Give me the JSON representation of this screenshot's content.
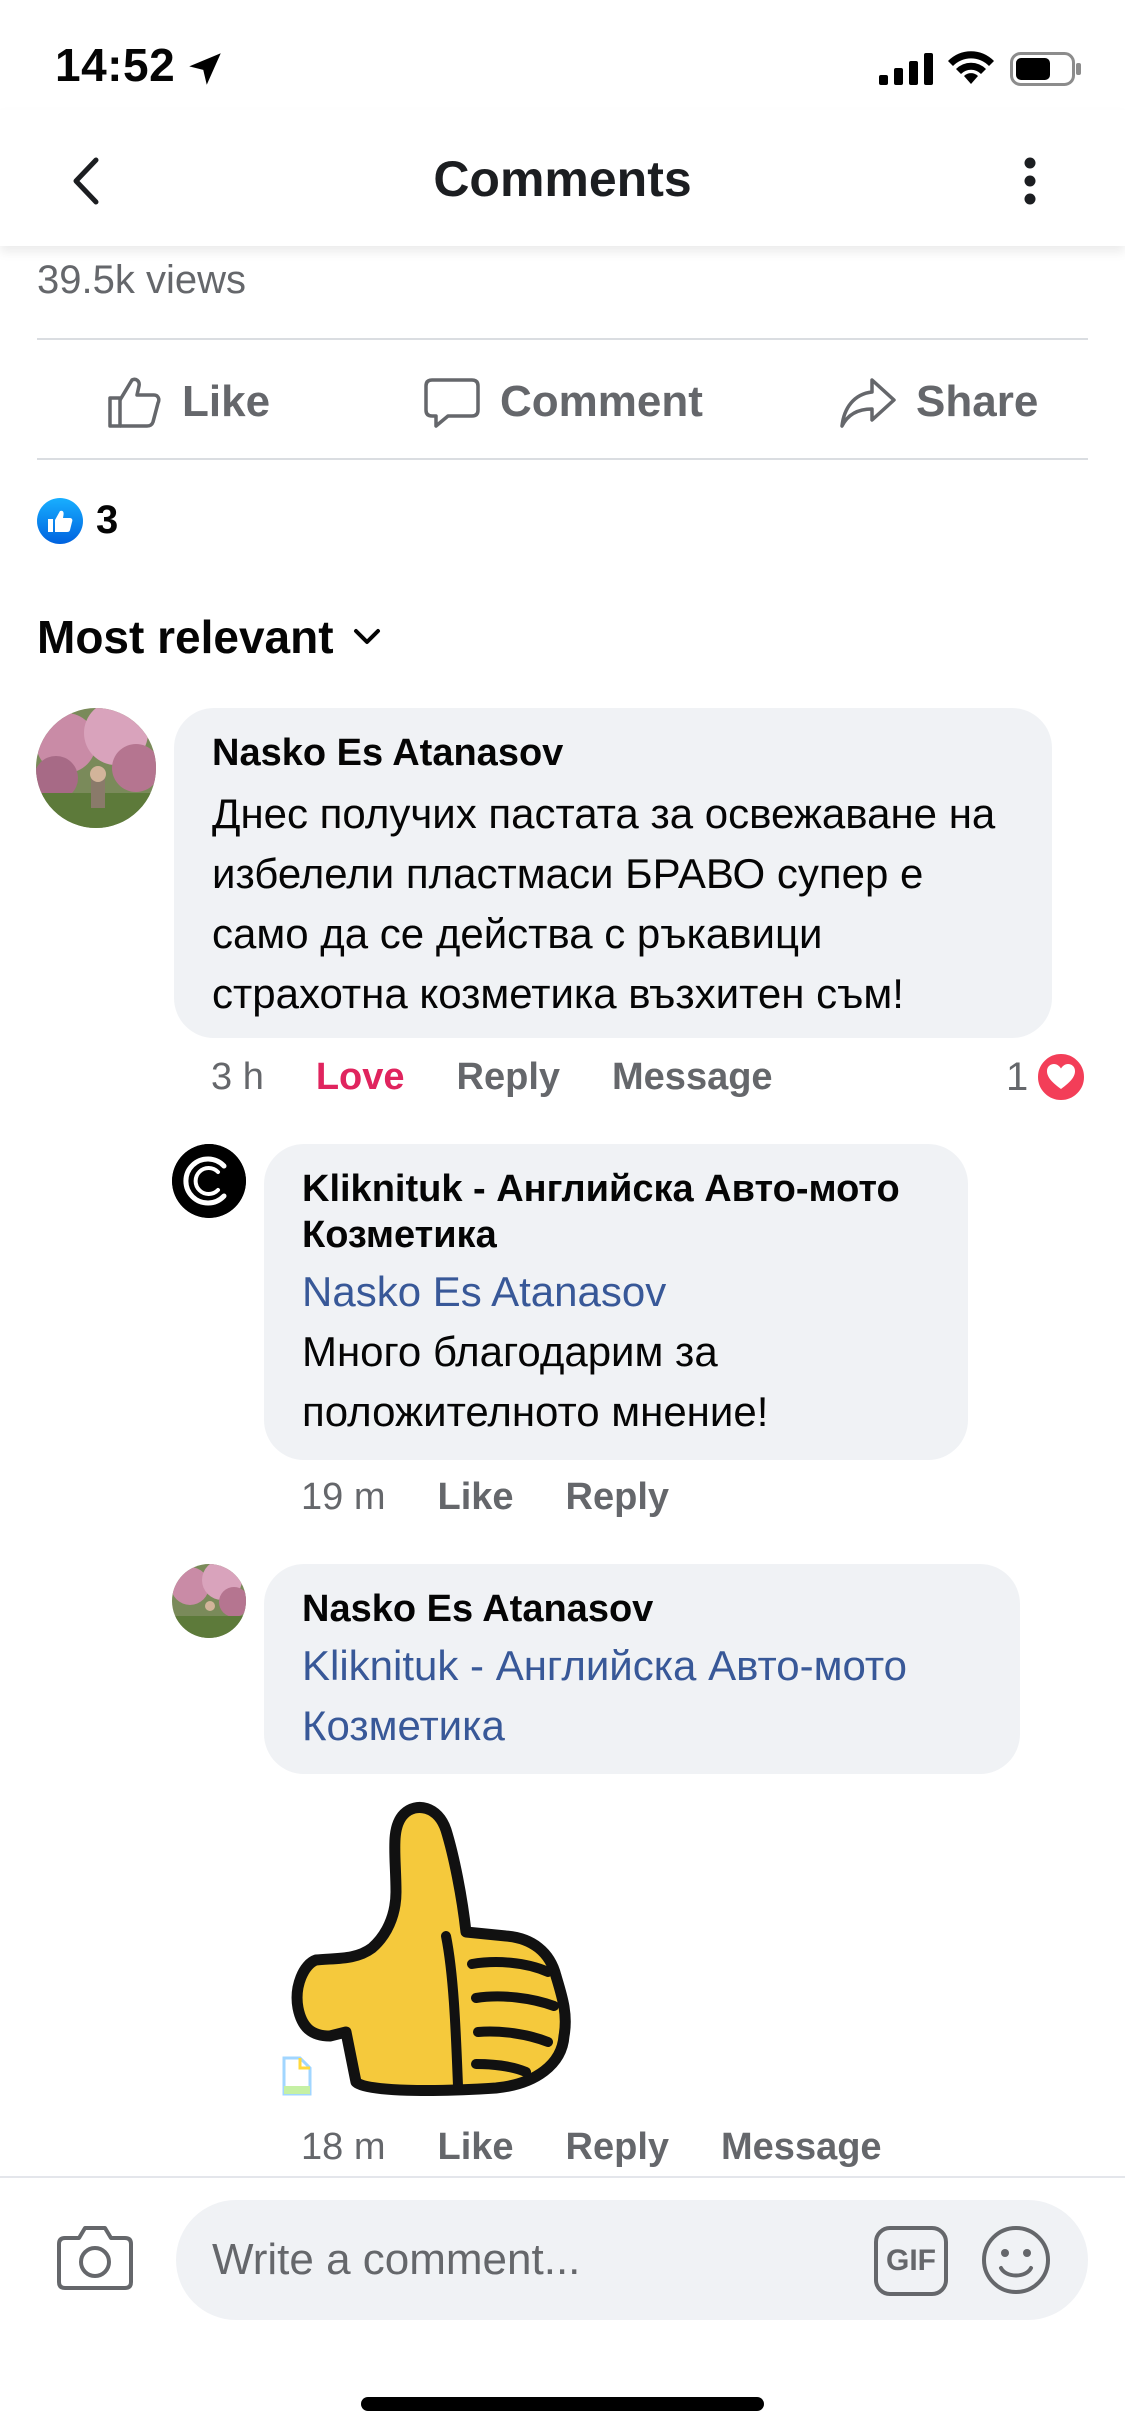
{
  "status_bar": {
    "time": "14:52"
  },
  "header": {
    "title": "Comments"
  },
  "post": {
    "views": "39.5k views",
    "actions": {
      "like": "Like",
      "comment": "Comment",
      "share": "Share"
    },
    "reaction_count": "3"
  },
  "sort": {
    "label": "Most relevant"
  },
  "comments": [
    {
      "author": "Nasko Es Atanasov",
      "text": "Днес получих пастата за освежаване на избелели пластмаси БРАВО супер е само да се действа с ръкавици страхотна козметика възхитен съм!",
      "time": "3 h",
      "reaction_label": "Love",
      "reply_label": "Reply",
      "message_label": "Message",
      "reaction_count": "1"
    },
    {
      "author": "Kliknituk - Английска Авто-мото Козметика",
      "mention": "Nasko Es Atanasov",
      "text": "Много благодарим за положителното мнение!",
      "time": "19 m",
      "like_label": "Like",
      "reply_label": "Reply"
    },
    {
      "author": "Nasko Es Atanasov",
      "mention": "Kliknituk - Английска Авто-мото Козметика",
      "time": "18 m",
      "like_label": "Like",
      "reply_label": "Reply",
      "message_label": "Message"
    }
  ],
  "composer": {
    "placeholder": "Write a comment...",
    "gif_label": "GIF"
  },
  "colors": {
    "accent_blue": "#1877f2",
    "love_red": "#e0245e",
    "mention_blue": "#385898",
    "bubble_gray": "#f0f2f5"
  }
}
